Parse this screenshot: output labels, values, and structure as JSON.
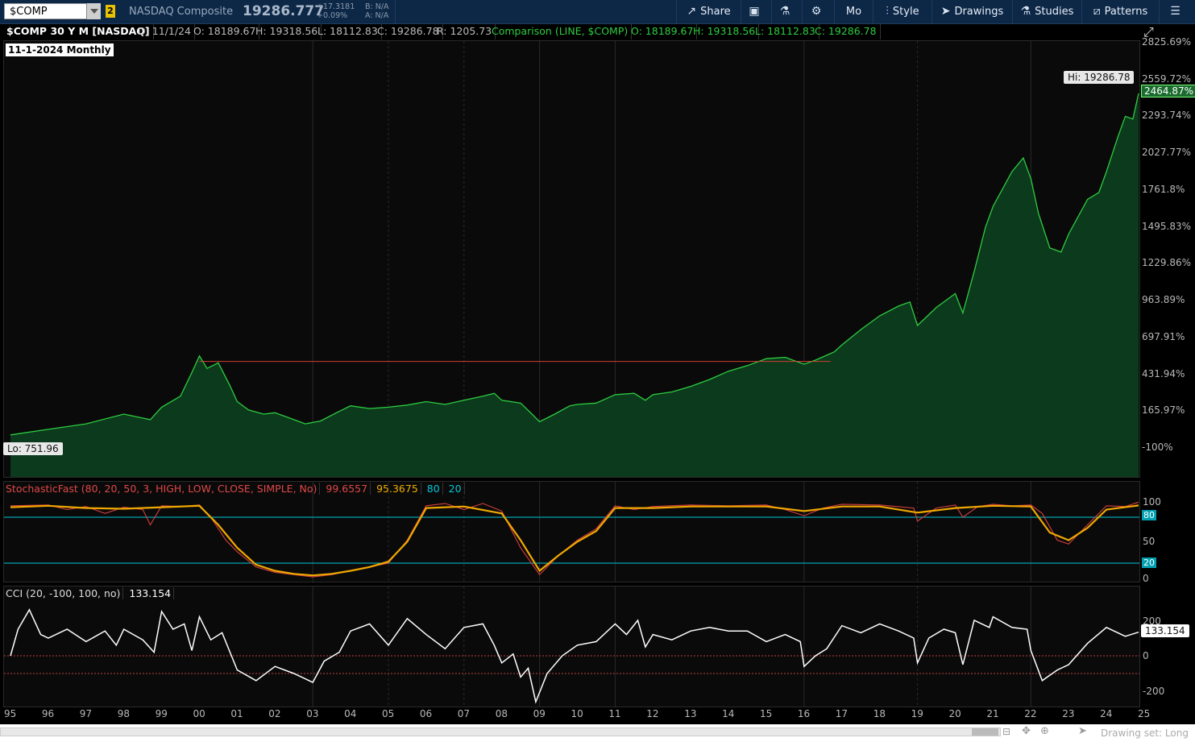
{
  "toolbar": {
    "symbol": "$COMP",
    "link_badge": "2",
    "description": "NASDAQ Composite",
    "last": "19286.777",
    "net_change": "+17.3181",
    "pct_change": "+0.09%",
    "bid": "B: N/A",
    "ask": "A: N/A",
    "buttons": {
      "share": "Share",
      "aggregation": "Mo",
      "style": "Style",
      "drawings": "Drawings",
      "studies": "Studies",
      "patterns": "Patterns"
    }
  },
  "header": {
    "title": "$COMP 30 Y M [NASDAQ]",
    "date": "D: 11/1/24",
    "open": "O: 18189.67",
    "high": "H: 19318.56",
    "low": "L: 18112.83",
    "close": "C: 19286.78",
    "range": "R: 1205.73",
    "comparison": "Comparison (LINE, $COMP)",
    "cmp_open": "O: 18189.67",
    "cmp_high": "H: 19318.56",
    "cmp_low": "L: 18112.83",
    "cmp_close": "C: 19286.78"
  },
  "price_panel": {
    "date_label": "11-1-2024 Monthly",
    "hi_label": "Hi: 19286.78",
    "lo_label": "Lo: 751.96",
    "current_pct": "2464.87%"
  },
  "stochastic": {
    "title": "StochasticFast (80, 20, 50, 3, HIGH, LOW, CLOSE, SIMPLE, No)",
    "k_value": "99.6557",
    "d_value": "95.3675",
    "over_bought": "80",
    "over_sold": "20",
    "axis": [
      "100",
      "50",
      "0"
    ]
  },
  "cci": {
    "title": "CCI (20, -100, 100, no)",
    "value": "133.154",
    "axis": [
      "200",
      "0",
      "-200"
    ]
  },
  "x_axis_labels": [
    "95",
    "96",
    "97",
    "98",
    "99",
    "00",
    "01",
    "02",
    "03",
    "04",
    "05",
    "06",
    "07",
    "08",
    "09",
    "10",
    "11",
    "12",
    "13",
    "14",
    "15",
    "16",
    "17",
    "18",
    "19",
    "20",
    "21",
    "22",
    "23",
    "24",
    "25"
  ],
  "footer": {
    "drawing_set": "Drawing set: Long"
  },
  "colors": {
    "area_fill": "#0b3a1c",
    "area_line": "#2ecc40",
    "stoch_k": "#d84040",
    "stoch_d": "#f0a800",
    "level_line": "#00c8d8",
    "cci_line": "#ffffff",
    "resistance": "#d04030"
  },
  "chart_data": [
    {
      "type": "area",
      "title": "$COMP 30 Y M [NASDAQ]",
      "y_axis_ticks": [
        "2825.69%",
        "2559.72%",
        "2293.74%",
        "2027.77%",
        "1761.8%",
        "1495.83%",
        "1229.86%",
        "963.89%",
        "697.91%",
        "431.94%",
        "165.97%",
        "-100%"
      ],
      "ylim": [
        -100,
        2825.69
      ],
      "points": [
        [
          1995.0,
          0
        ],
        [
          1996.0,
          40
        ],
        [
          1997.0,
          80
        ],
        [
          1998.0,
          150
        ],
        [
          1998.7,
          110
        ],
        [
          1999.0,
          200
        ],
        [
          1999.5,
          280
        ],
        [
          1999.8,
          450
        ],
        [
          2000.0,
          570
        ],
        [
          2000.2,
          480
        ],
        [
          2000.5,
          520
        ],
        [
          2000.8,
          360
        ],
        [
          2001.0,
          240
        ],
        [
          2001.3,
          180
        ],
        [
          2001.7,
          150
        ],
        [
          2002.0,
          160
        ],
        [
          2002.5,
          110
        ],
        [
          2002.8,
          80
        ],
        [
          2003.2,
          100
        ],
        [
          2003.7,
          170
        ],
        [
          2004.0,
          210
        ],
        [
          2004.5,
          190
        ],
        [
          2005.0,
          200
        ],
        [
          2005.5,
          215
        ],
        [
          2006.0,
          240
        ],
        [
          2006.5,
          220
        ],
        [
          2007.0,
          250
        ],
        [
          2007.5,
          280
        ],
        [
          2007.8,
          300
        ],
        [
          2008.0,
          250
        ],
        [
          2008.5,
          230
        ],
        [
          2008.8,
          150
        ],
        [
          2009.0,
          95
        ],
        [
          2009.4,
          150
        ],
        [
          2009.8,
          210
        ],
        [
          2010.0,
          220
        ],
        [
          2010.5,
          230
        ],
        [
          2011.0,
          290
        ],
        [
          2011.5,
          300
        ],
        [
          2011.8,
          250
        ],
        [
          2012.0,
          290
        ],
        [
          2012.5,
          310
        ],
        [
          2013.0,
          350
        ],
        [
          2013.5,
          400
        ],
        [
          2014.0,
          460
        ],
        [
          2014.5,
          500
        ],
        [
          2015.0,
          550
        ],
        [
          2015.5,
          560
        ],
        [
          2016.0,
          510
        ],
        [
          2016.3,
          540
        ],
        [
          2016.8,
          600
        ],
        [
          2017.0,
          650
        ],
        [
          2017.5,
          760
        ],
        [
          2018.0,
          860
        ],
        [
          2018.5,
          930
        ],
        [
          2018.8,
          960
        ],
        [
          2019.0,
          790
        ],
        [
          2019.5,
          920
        ],
        [
          2020.0,
          1020
        ],
        [
          2020.2,
          880
        ],
        [
          2020.5,
          1180
        ],
        [
          2020.8,
          1500
        ],
        [
          2021.0,
          1650
        ],
        [
          2021.5,
          1900
        ],
        [
          2021.8,
          2000
        ],
        [
          2022.0,
          1850
        ],
        [
          2022.2,
          1600
        ],
        [
          2022.5,
          1350
        ],
        [
          2022.8,
          1320
        ],
        [
          2023.0,
          1450
        ],
        [
          2023.5,
          1700
        ],
        [
          2023.8,
          1750
        ],
        [
          2024.0,
          1900
        ],
        [
          2024.3,
          2150
        ],
        [
          2024.5,
          2300
        ],
        [
          2024.7,
          2280
        ],
        [
          2024.85,
          2464.87
        ]
      ],
      "resistance_level_pct": 530,
      "hi": 19286.78,
      "lo": 751.96
    },
    {
      "type": "line",
      "title": "StochasticFast (80, 20, 50, 3, HIGH, LOW, CLOSE, SIMPLE, No)",
      "ylim": [
        0,
        100
      ],
      "levels": [
        80,
        20
      ],
      "series": [
        {
          "name": "FullK",
          "x": [
            1995.0,
            1996.0,
            1996.5,
            1997.0,
            1997.5,
            1998.0,
            1998.5,
            1998.7,
            1999.0,
            1999.5,
            2000.0,
            2000.3,
            2000.7,
            2001.0,
            2001.5,
            2002.0,
            2002.5,
            2003.0,
            2003.5,
            2004.0,
            2004.5,
            2005.0,
            2005.5,
            2006.0,
            2006.5,
            2007.0,
            2007.5,
            2008.0,
            2008.5,
            2009.0,
            2009.5,
            2010.0,
            2010.5,
            2011.0,
            2011.5,
            2012.0,
            2013.0,
            2014.0,
            2015.0,
            2015.5,
            2016.0,
            2016.5,
            2017.0,
            2018.0,
            2018.9,
            2019.0,
            2019.5,
            2020.0,
            2020.2,
            2020.6,
            2021.0,
            2021.5,
            2022.0,
            2022.3,
            2022.7,
            2023.0,
            2023.5,
            2024.0,
            2024.5,
            2024.85
          ],
          "values": [
            95,
            96,
            90,
            94,
            85,
            93,
            90,
            70,
            95,
            94,
            96,
            80,
            50,
            35,
            15,
            8,
            5,
            2,
            5,
            10,
            15,
            20,
            50,
            95,
            98,
            90,
            98,
            88,
            40,
            5,
            30,
            50,
            65,
            95,
            90,
            94,
            96,
            95,
            96,
            90,
            82,
            92,
            97,
            96,
            92,
            75,
            92,
            96,
            80,
            94,
            97,
            95,
            96,
            85,
            50,
            45,
            70,
            95,
            94,
            99.66
          ]
        },
        {
          "name": "FullD",
          "x": [
            1995.0,
            1996.0,
            1997.0,
            1998.0,
            1999.0,
            2000.0,
            2000.5,
            2001.0,
            2001.5,
            2002.0,
            2002.5,
            2003.0,
            2003.5,
            2004.0,
            2004.5,
            2005.0,
            2005.5,
            2006.0,
            2007.0,
            2008.0,
            2008.5,
            2009.0,
            2009.5,
            2010.0,
            2010.5,
            2011.0,
            2012.0,
            2013.0,
            2014.0,
            2015.0,
            2016.0,
            2017.0,
            2018.0,
            2019.0,
            2020.0,
            2021.0,
            2022.0,
            2022.5,
            2023.0,
            2023.5,
            2024.0,
            2024.85
          ],
          "values": [
            93,
            95,
            92,
            91,
            93,
            95,
            70,
            40,
            18,
            10,
            6,
            4,
            6,
            10,
            15,
            22,
            48,
            92,
            94,
            85,
            50,
            10,
            30,
            48,
            62,
            92,
            92,
            94,
            94,
            94,
            88,
            94,
            94,
            86,
            92,
            95,
            94,
            60,
            50,
            66,
            90,
            95.37
          ]
        }
      ]
    },
    {
      "type": "line",
      "title": "CCI (20, -100, 100, no)",
      "ylim": [
        -250,
        300
      ],
      "levels": [
        0,
        -100
      ],
      "series": [
        {
          "name": "CCI",
          "x": [
            1995.0,
            1995.2,
            1995.5,
            1995.8,
            1996.0,
            1996.5,
            1997.0,
            1997.5,
            1997.8,
            1998.0,
            1998.5,
            1998.8,
            1999.0,
            1999.3,
            1999.6,
            1999.8,
            2000.0,
            2000.3,
            2000.6,
            2001.0,
            2001.5,
            2002.0,
            2002.5,
            2003.0,
            2003.3,
            2003.7,
            2004.0,
            2004.5,
            2005.0,
            2005.5,
            2006.0,
            2006.5,
            2007.0,
            2007.5,
            2007.8,
            2008.0,
            2008.3,
            2008.5,
            2008.7,
            2008.9,
            2009.2,
            2009.6,
            2010.0,
            2010.5,
            2011.0,
            2011.3,
            2011.6,
            2011.8,
            2012.0,
            2012.5,
            2013.0,
            2013.5,
            2014.0,
            2014.5,
            2015.0,
            2015.5,
            2015.9,
            2016.0,
            2016.3,
            2016.6,
            2017.0,
            2017.5,
            2018.0,
            2018.5,
            2018.9,
            2019.0,
            2019.3,
            2019.7,
            2020.0,
            2020.2,
            2020.5,
            2020.9,
            2021.0,
            2021.5,
            2021.9,
            2022.0,
            2022.3,
            2022.7,
            2023.0,
            2023.5,
            2024.0,
            2024.5,
            2024.85
          ],
          "values": [
            0,
            150,
            260,
            120,
            100,
            150,
            80,
            140,
            60,
            150,
            90,
            20,
            250,
            150,
            180,
            30,
            220,
            90,
            130,
            -80,
            -140,
            -60,
            -100,
            -150,
            -30,
            20,
            140,
            180,
            60,
            210,
            120,
            40,
            160,
            180,
            60,
            -40,
            10,
            -120,
            -70,
            -260,
            -100,
            0,
            60,
            80,
            180,
            120,
            200,
            50,
            120,
            90,
            140,
            160,
            140,
            140,
            80,
            120,
            80,
            -60,
            0,
            40,
            170,
            130,
            180,
            140,
            100,
            -40,
            100,
            150,
            130,
            -50,
            200,
            160,
            220,
            160,
            150,
            30,
            -140,
            -80,
            -50,
            70,
            160,
            110,
            133.15
          ]
        }
      ]
    }
  ]
}
